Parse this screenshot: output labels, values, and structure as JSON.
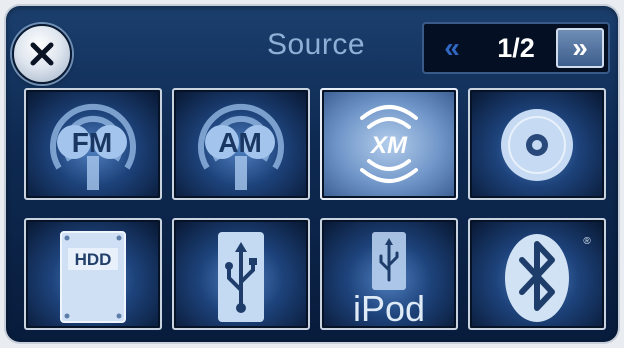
{
  "header": {
    "title": "Source",
    "page_indicator": "1/2",
    "prev_glyph": "«",
    "next_glyph": "»",
    "close_icon": "close-icon"
  },
  "sources": [
    {
      "label": "FM",
      "icon": "fm-radio-icon"
    },
    {
      "label": "AM",
      "icon": "am-radio-icon"
    },
    {
      "label": "XM",
      "icon": "xm-satellite-icon",
      "selected": true
    },
    {
      "label": "",
      "icon": "disc-icon"
    },
    {
      "label": "HDD",
      "icon": "hdd-icon"
    },
    {
      "label": "",
      "icon": "usb-icon"
    },
    {
      "label": "iPod",
      "icon": "ipod-icon"
    },
    {
      "label": "®",
      "icon": "bluetooth-icon"
    }
  ],
  "colors": {
    "background": "#0e2a52",
    "title": "#8fb0d6",
    "tile_border": "#c9d3e0",
    "selected_tile": "#6f95c8"
  }
}
